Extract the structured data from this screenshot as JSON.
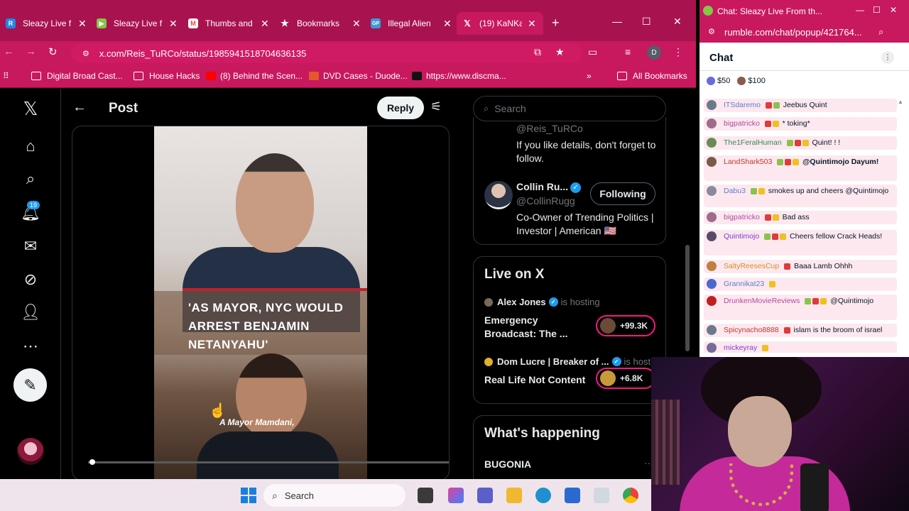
{
  "browser": {
    "tabs": [
      {
        "label": "Sleazy Live f",
        "icon": "R",
        "icon_color": "#1e88e5"
      },
      {
        "label": "Sleazy Live f",
        "icon": "▶",
        "icon_color": "#85c742"
      },
      {
        "label": "Thumbs and",
        "icon": "M",
        "icon_color": "#ea4335"
      },
      {
        "label": "Bookmarks",
        "icon": "★",
        "icon_color": "transparent"
      },
      {
        "label": "Illegal Alien",
        "icon": "GP",
        "icon_color": "#3a9ad9"
      },
      {
        "label": "(19) KaNKa",
        "icon": "𝕏",
        "icon_color": "transparent"
      }
    ],
    "url": "x.com/Reis_TuRCo/status/1985941518704636135",
    "profile_initial": "D",
    "bookmarks": [
      {
        "label": "Digital Broad Cast...",
        "kind": "folder"
      },
      {
        "label": "House Hacks",
        "kind": "folder"
      },
      {
        "label": "(8) Behind the Scen...",
        "kind": "youtube"
      },
      {
        "label": "DVD Cases - Duode...",
        "kind": "site"
      },
      {
        "label": "https://www.discma...",
        "kind": "site"
      }
    ],
    "all_bookmarks": "All Bookmarks"
  },
  "x": {
    "notif_count": "19",
    "post_title": "Post",
    "reply_label": "Reply",
    "video_caption": "'AS MAYOR, NYC WOULD ARREST BENJAMIN NETANYAHU'",
    "video_subtitle": "A Mayor Mamdani,",
    "search_placeholder": "Search",
    "who": {
      "handle1": "@Reis_TuRCo",
      "bio1": "If you like details, don't forget to follow.",
      "name2": "Collin Ru...",
      "handle2": "@CollinRugg",
      "follow_state": "Following",
      "bio2": "Co-Owner of Trending Politics | Investor | American 🇺🇸"
    },
    "live": {
      "title": "Live on X",
      "items": [
        {
          "host": "Alex Jones",
          "hosting": "is hosting",
          "name": "Emergency Broadcast: The ...",
          "count": "+99.3K"
        },
        {
          "host": "Dom Lucre | Breaker of ...",
          "hosting": "is hosting",
          "name": "Real Life Not Content",
          "count": "+6.8K"
        }
      ]
    },
    "happening": {
      "title": "What's happening",
      "item": "BUGONIA",
      "more": "···"
    }
  },
  "chat_window": {
    "window_title": "Chat: Sleazy Live From th...",
    "url": "rumble.com/chat/popup/421764...",
    "title": "Chat",
    "rants": [
      "$50",
      "$100"
    ],
    "messages": [
      {
        "user": "ITSdaremo",
        "text": "Jeebus Quint",
        "color": "#5b7fd0"
      },
      {
        "user": "bigpatricko",
        "text": "* toking*",
        "color": "#b04aa0"
      },
      {
        "user": "The1FeralHuman",
        "text": "Quint! ! !",
        "color": "#2e8b57"
      },
      {
        "user": "LandShark503",
        "text": "@Quintimojo Dayum!",
        "color": "#c0392b"
      },
      {
        "user": "Dabu3",
        "text": "smokes up and cheers @Quintimojo",
        "color": "#5b7fd0"
      },
      {
        "user": "bigpatricko",
        "text": "Bad ass",
        "color": "#b04aa0"
      },
      {
        "user": "Quintimojo",
        "text": "Cheers fellow Crack Heads!",
        "color": "#7b3fd0"
      },
      {
        "user": "SaltyReesesCup",
        "text": "Baaa Lamb Ohhh",
        "color": "#d4901a"
      },
      {
        "user": "Grannikat23",
        "text": "",
        "color": "#5b7fd0"
      },
      {
        "user": "DrunkenMovieReviews",
        "text": "@Quintimojo",
        "color": "#b04aa0"
      },
      {
        "user": "Spicynacho8888",
        "text": "islam is the broom of israel",
        "color": "#c0392b"
      },
      {
        "user": "mickeyray",
        "text": "",
        "color": "#7b3fd0"
      }
    ]
  },
  "taskbar": {
    "search_label": "Search"
  }
}
